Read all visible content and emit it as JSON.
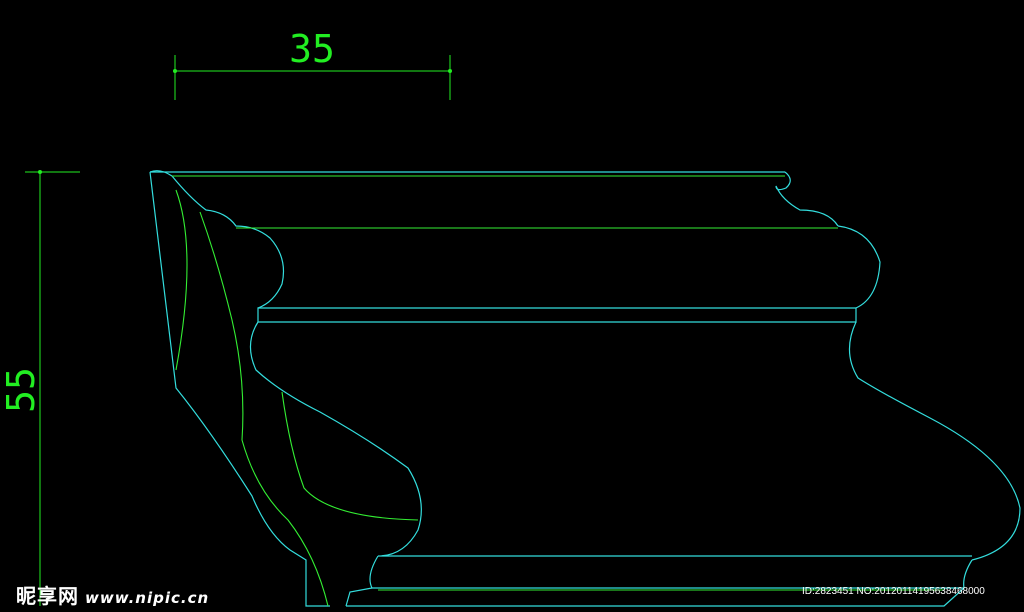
{
  "dimensions": {
    "horizontal": "35",
    "vertical": "55"
  },
  "colors": {
    "background": "#000000",
    "dimension": "#22ee22",
    "outline_cyan": "#33dddd",
    "inner_green": "#33ee33"
  },
  "watermark": {
    "logo": "昵享网",
    "site": "www.nipic.cn",
    "id_text": "ID:2823451 NO:20120114195638468000"
  }
}
